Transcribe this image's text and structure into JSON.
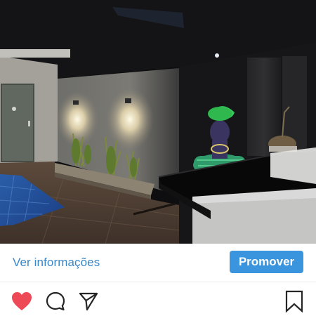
{
  "post": {
    "photo": "night-interior-pool-bar-statue"
  },
  "cta": {
    "link_label": "Ver informações",
    "promote_label": "Promover"
  },
  "actions": {
    "like_icon": "heart-icon",
    "comment_icon": "comment-icon",
    "share_icon": "send-icon",
    "save_icon": "bookmark-icon",
    "like_color": "#ed4956"
  },
  "colors": {
    "link": "#3a86c8",
    "button": "#3b95de"
  }
}
